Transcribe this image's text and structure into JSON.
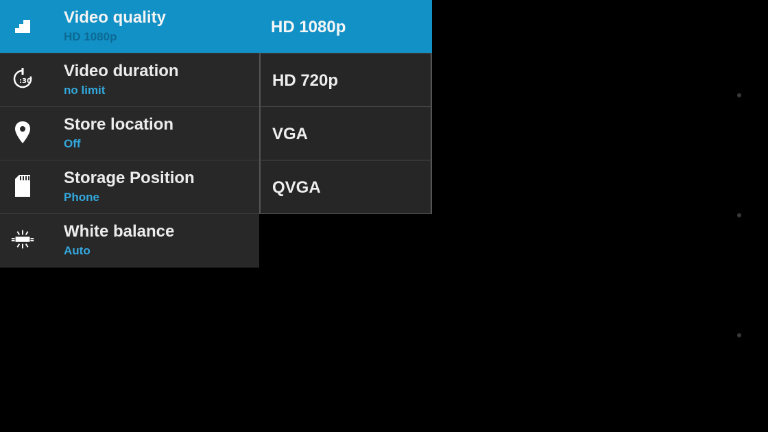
{
  "settings": [
    {
      "title": "Video quality",
      "value": "HD 1080p",
      "icon": "video-quality-icon"
    },
    {
      "title": "Video duration",
      "value": "no limit",
      "icon": "timer-30-icon"
    },
    {
      "title": "Store location",
      "value": "Off",
      "icon": "location-pin-icon"
    },
    {
      "title": "Storage Position",
      "value": "Phone",
      "icon": "sd-card-icon"
    },
    {
      "title": "White balance",
      "value": "Auto",
      "icon": "white-balance-fluorescent-icon"
    }
  ],
  "options": [
    {
      "label": "HD 1080p",
      "selected": true
    },
    {
      "label": "HD 720p",
      "selected": false
    },
    {
      "label": "VGA",
      "selected": false
    },
    {
      "label": "QVGA",
      "selected": false
    }
  ],
  "timer_icon_text": ":30",
  "colors": {
    "accent": "#1291c6",
    "value_text": "#33a8de",
    "row_background": "#282828",
    "background": "#000000"
  }
}
